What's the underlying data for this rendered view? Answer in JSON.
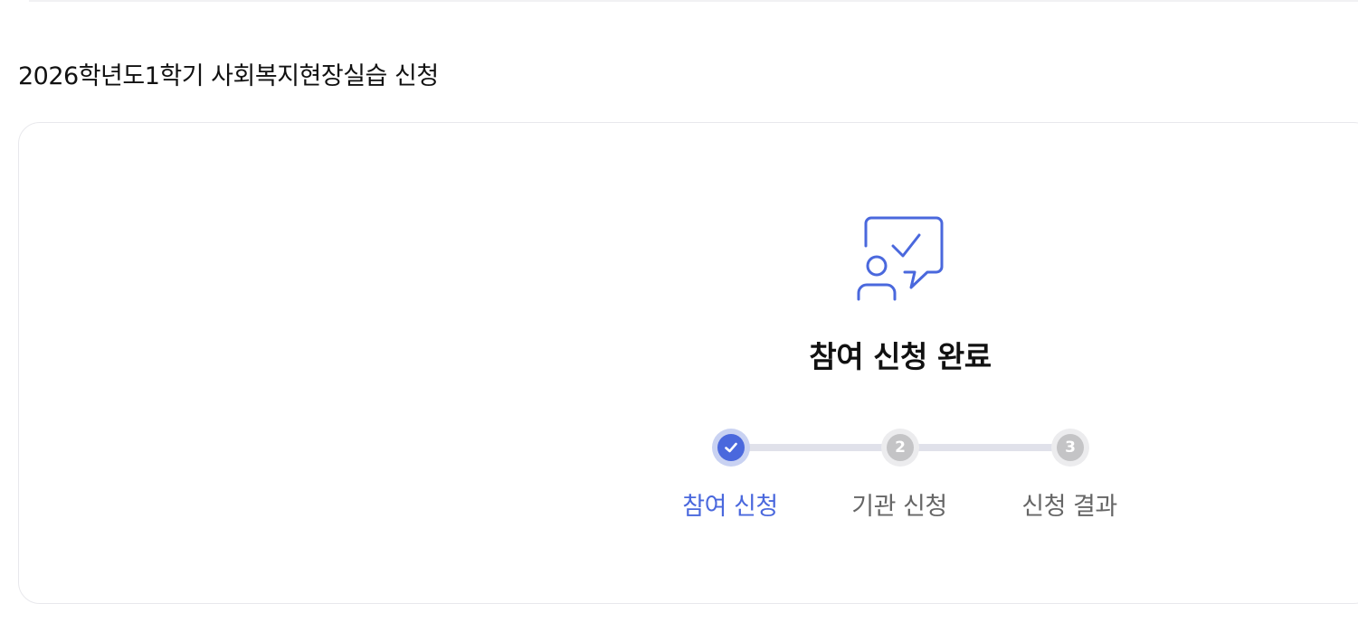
{
  "page": {
    "title": "2026학년도1학기 사회복지현장실습 신청"
  },
  "status": {
    "heading": "참여 신청 완료",
    "icon": "person-chat-check-icon",
    "accent_color": "#4a68dd"
  },
  "steps": [
    {
      "label": "참여 신청",
      "marker": "",
      "state": "completed",
      "icon": "check-icon"
    },
    {
      "label": "기관 신청",
      "marker": "2",
      "state": "pending"
    },
    {
      "label": "신청 결과",
      "marker": "3",
      "state": "pending"
    }
  ],
  "colors": {
    "completed": "#4a68dd",
    "pending": "#c4c4c6",
    "track": "#e0e1ea",
    "text": "#111111",
    "muted_text": "#666666"
  }
}
